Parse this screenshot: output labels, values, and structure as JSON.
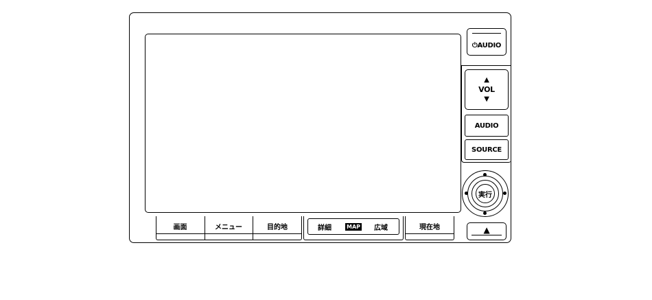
{
  "audio_power_button": {
    "label": "⏻AUDIO"
  },
  "volume": {
    "label": "VOL",
    "up": "▲",
    "down": "▼"
  },
  "audio_button": {
    "label": "AUDIO"
  },
  "source_button": {
    "label": "SOURCE"
  },
  "enter_knob": {
    "label": "実行"
  },
  "eject_button": {
    "label": "▲"
  },
  "bottom_buttons": {
    "screen": "画面",
    "menu": "メニュー",
    "destination": "目的地",
    "detail": "詳細",
    "map_badge": "MAP",
    "wide": "広域",
    "current_location": "現在地"
  }
}
